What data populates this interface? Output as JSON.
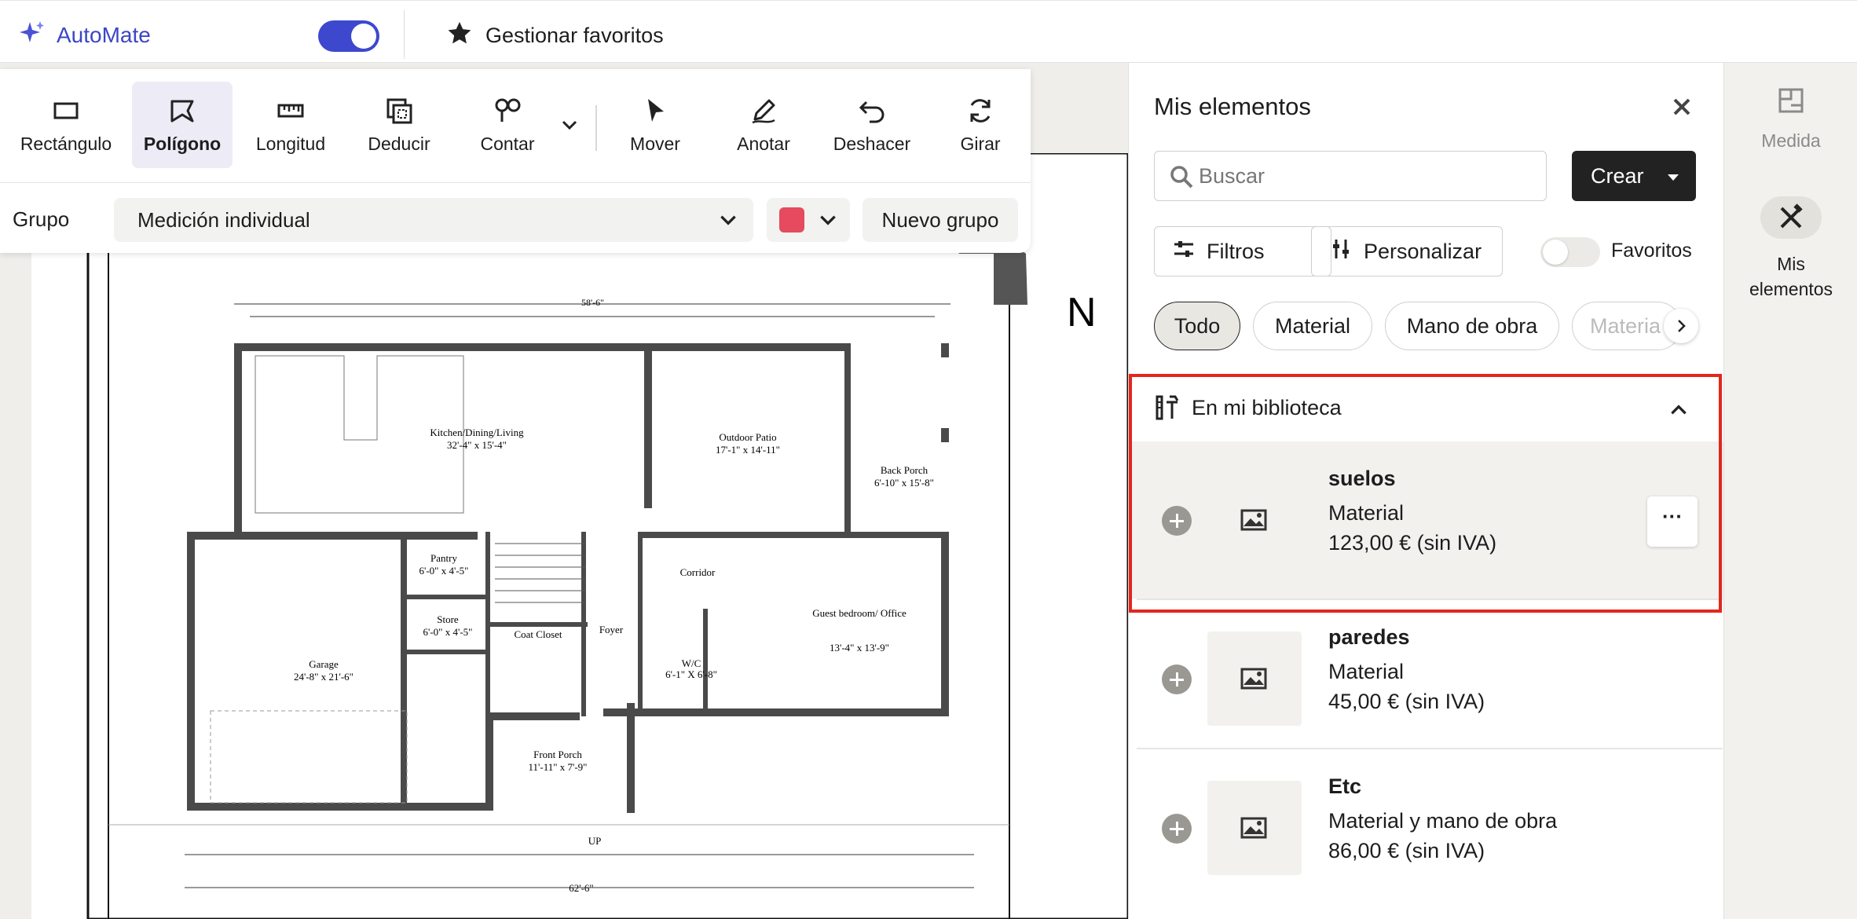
{
  "header": {
    "brand_label": "AutoMate",
    "automate_toggle_on": true,
    "manage_favorites_label": "Gestionar favoritos"
  },
  "toolbar": {
    "tools": [
      {
        "label": "Rectángulo",
        "icon": "rectangle-icon",
        "active": false
      },
      {
        "label": "Polígono",
        "icon": "polygon-icon",
        "active": true
      },
      {
        "label": "Longitud",
        "icon": "ruler-icon",
        "active": false
      },
      {
        "label": "Deducir",
        "icon": "deduct-icon",
        "active": false
      },
      {
        "label": "Contar",
        "icon": "count-icon",
        "active": false
      },
      {
        "label": "Mover",
        "icon": "cursor-icon",
        "active": false
      },
      {
        "label": "Anotar",
        "icon": "pen-icon",
        "active": false
      },
      {
        "label": "Deshacer",
        "icon": "undo-icon",
        "active": false
      },
      {
        "label": "Girar",
        "icon": "rotate-icon",
        "active": false
      }
    ],
    "group_label": "Grupo",
    "group_value": "Medición individual",
    "group_color": "#e54a5e",
    "new_group_label": "Nuevo grupo"
  },
  "floorplan": {
    "total_width": "58'-6\"",
    "total_bottom": "62'-6\"",
    "north": "N",
    "rooms": [
      {
        "name": "Kitchen/Dining/Living",
        "dim": "32'-4\" x 15'-4\""
      },
      {
        "name": "Outdoor Patio",
        "dim": "17'-1\" x 14'-11\""
      },
      {
        "name": "Back Porch",
        "dim": "6'-10\" x 15'-8\""
      },
      {
        "name": "Pantry",
        "dim": "6'-0\" x 4'-5\""
      },
      {
        "name": "Store",
        "dim": "6'-0\" x 4'-5\""
      },
      {
        "name": "Coat Closet",
        "dim": ""
      },
      {
        "name": "Foyer",
        "dim": ""
      },
      {
        "name": "Corridor",
        "dim": ""
      },
      {
        "name": "W/C",
        "dim": "6'-1\" X 6'-8\""
      },
      {
        "name": "Guest bedroom/ Office",
        "dim": "13'-4\" x 13'-9\""
      },
      {
        "name": "Garage",
        "dim": "24'-8\" x 21'-6\""
      },
      {
        "name": "Front Porch",
        "dim": "11'-11\" x 7'-9\""
      }
    ],
    "up_label": "UP"
  },
  "panel": {
    "title": "Mis elementos",
    "search_placeholder": "Buscar",
    "create_label": "Crear",
    "filters_label": "Filtros",
    "customize_label": "Personalizar",
    "favorites_label": "Favoritos",
    "chips": [
      {
        "label": "Todo",
        "active": true
      },
      {
        "label": "Material",
        "active": false
      },
      {
        "label": "Mano de obra",
        "active": false
      },
      {
        "label": "Materia",
        "active": false
      }
    ],
    "library_label": "En mi biblioteca",
    "items": [
      {
        "name": "suelos",
        "type": "Material",
        "price": "123,00 € (sin IVA)",
        "selected": true,
        "menu": "···"
      },
      {
        "name": "paredes",
        "type": "Material",
        "price": "45,00 € (sin IVA)",
        "selected": false
      },
      {
        "name": "Etc",
        "type": "Material y mano de obra",
        "price": "86,00 € (sin IVA)",
        "selected": false
      }
    ]
  },
  "rail": {
    "items": [
      {
        "label": "Medida",
        "icon": "layout-icon"
      },
      {
        "label": "Mis elementos",
        "icon": "tools-icon"
      }
    ]
  },
  "colors": {
    "brand": "#3b46c4",
    "toggle": "#3d48cf",
    "highlight": "#e3261c"
  }
}
